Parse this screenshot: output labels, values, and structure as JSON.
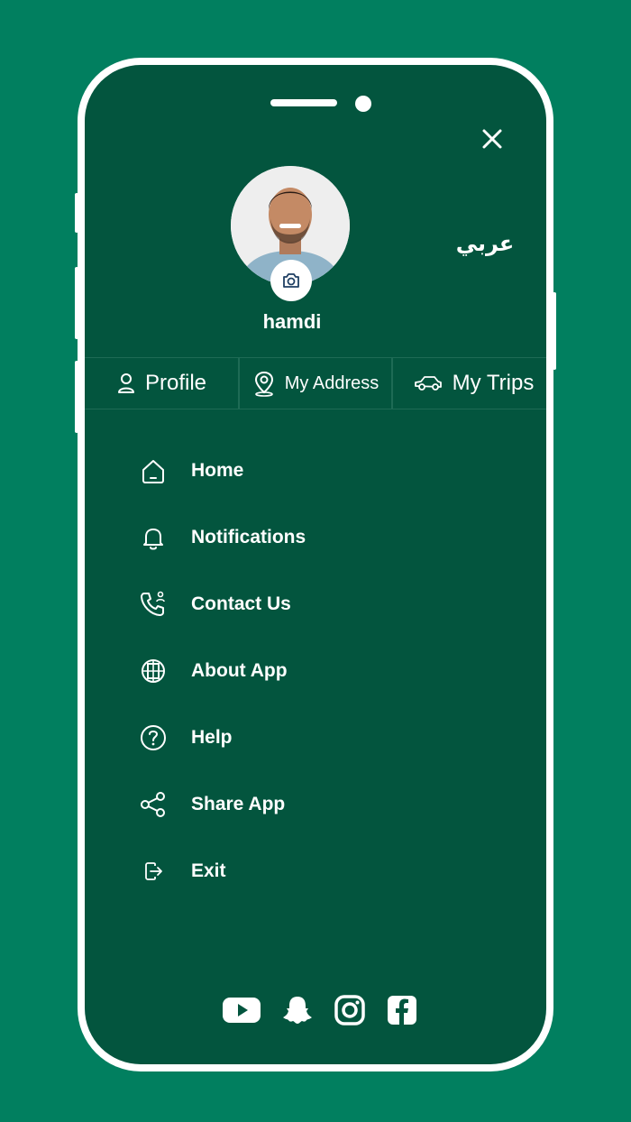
{
  "colors": {
    "background": "#017f5f",
    "screen": "#03553e",
    "frame": "#ffffff"
  },
  "header": {
    "language_toggle": "عربي",
    "close_icon": "close-icon"
  },
  "profile": {
    "username": "hamdi",
    "camera_icon": "camera-icon"
  },
  "tabs": [
    {
      "label": "Profile",
      "icon": "user-icon"
    },
    {
      "label": "My Address",
      "icon": "location-pin-icon"
    },
    {
      "label": "My Trips",
      "icon": "car-icon"
    }
  ],
  "menu": [
    {
      "label": "Home",
      "icon": "home-icon"
    },
    {
      "label": "Notifications",
      "icon": "bell-icon"
    },
    {
      "label": "Contact Us",
      "icon": "phone-icon"
    },
    {
      "label": "About App",
      "icon": "info-cube-icon"
    },
    {
      "label": "Help",
      "icon": "help-icon"
    },
    {
      "label": "Share App",
      "icon": "share-icon"
    },
    {
      "label": "Exit",
      "icon": "exit-icon"
    }
  ],
  "social": [
    "youtube-icon",
    "snapchat-icon",
    "instagram-icon",
    "facebook-icon"
  ]
}
